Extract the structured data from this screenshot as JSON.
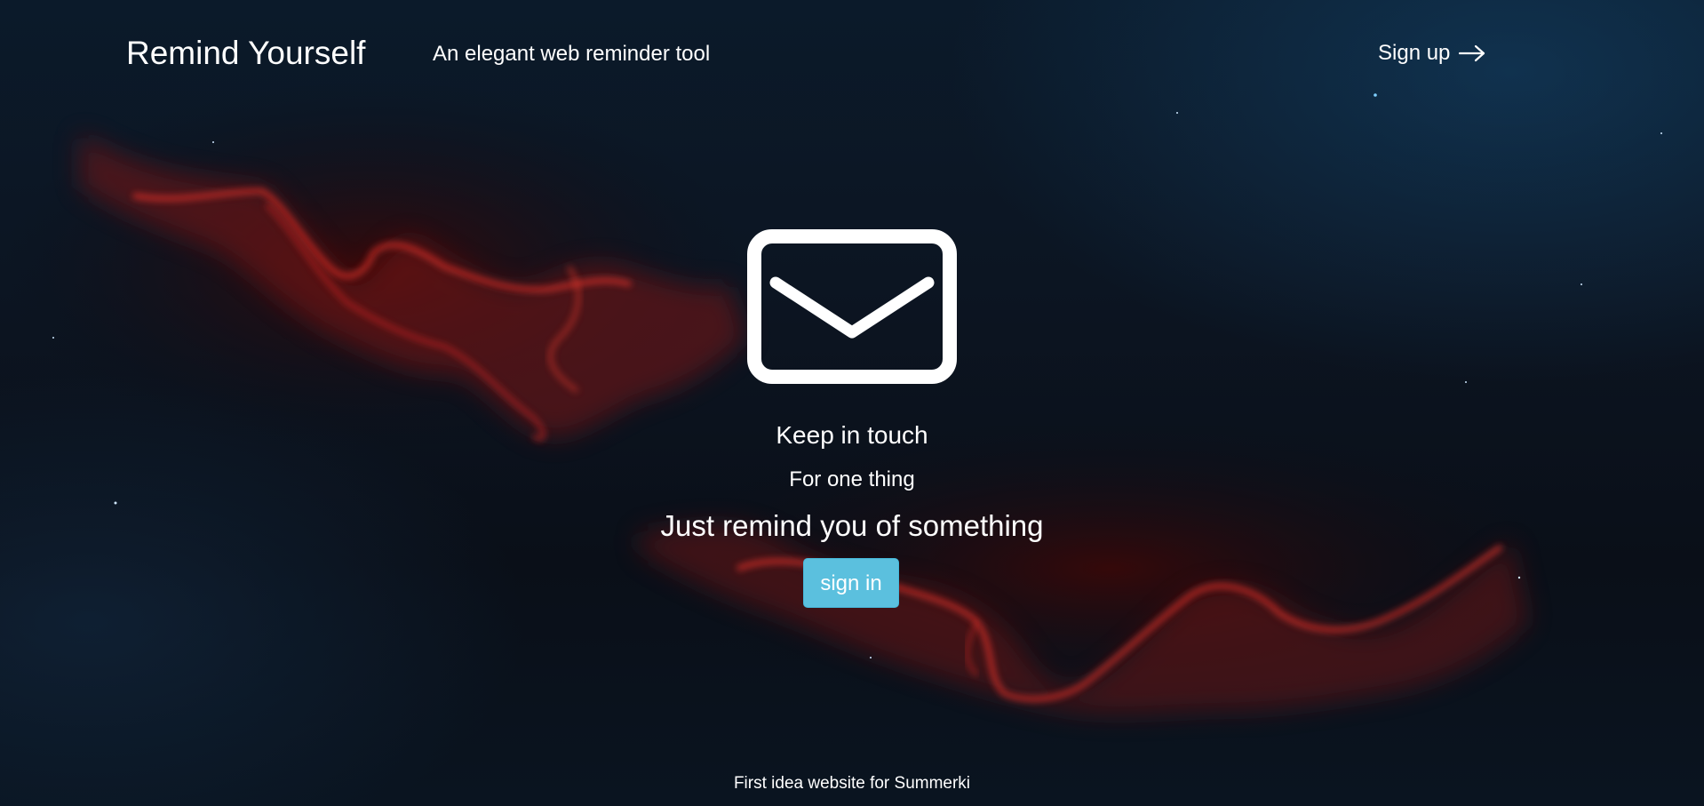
{
  "header": {
    "brand": "Remind Yourself",
    "tagline": "An elegant web reminder tool",
    "signup_label": "Sign up",
    "signup_icon": "arrow-right-icon"
  },
  "hero": {
    "icon": "envelope-icon",
    "line1": "Keep in touch",
    "line2": "For one thing",
    "line3": "Just remind you of something",
    "signin_label": "sign in"
  },
  "footer": {
    "text": "First idea website for Summerki"
  },
  "colors": {
    "button": "#5bc0de",
    "text": "#ffffff",
    "nebula": "#c0201c",
    "background": "#0b1520"
  }
}
